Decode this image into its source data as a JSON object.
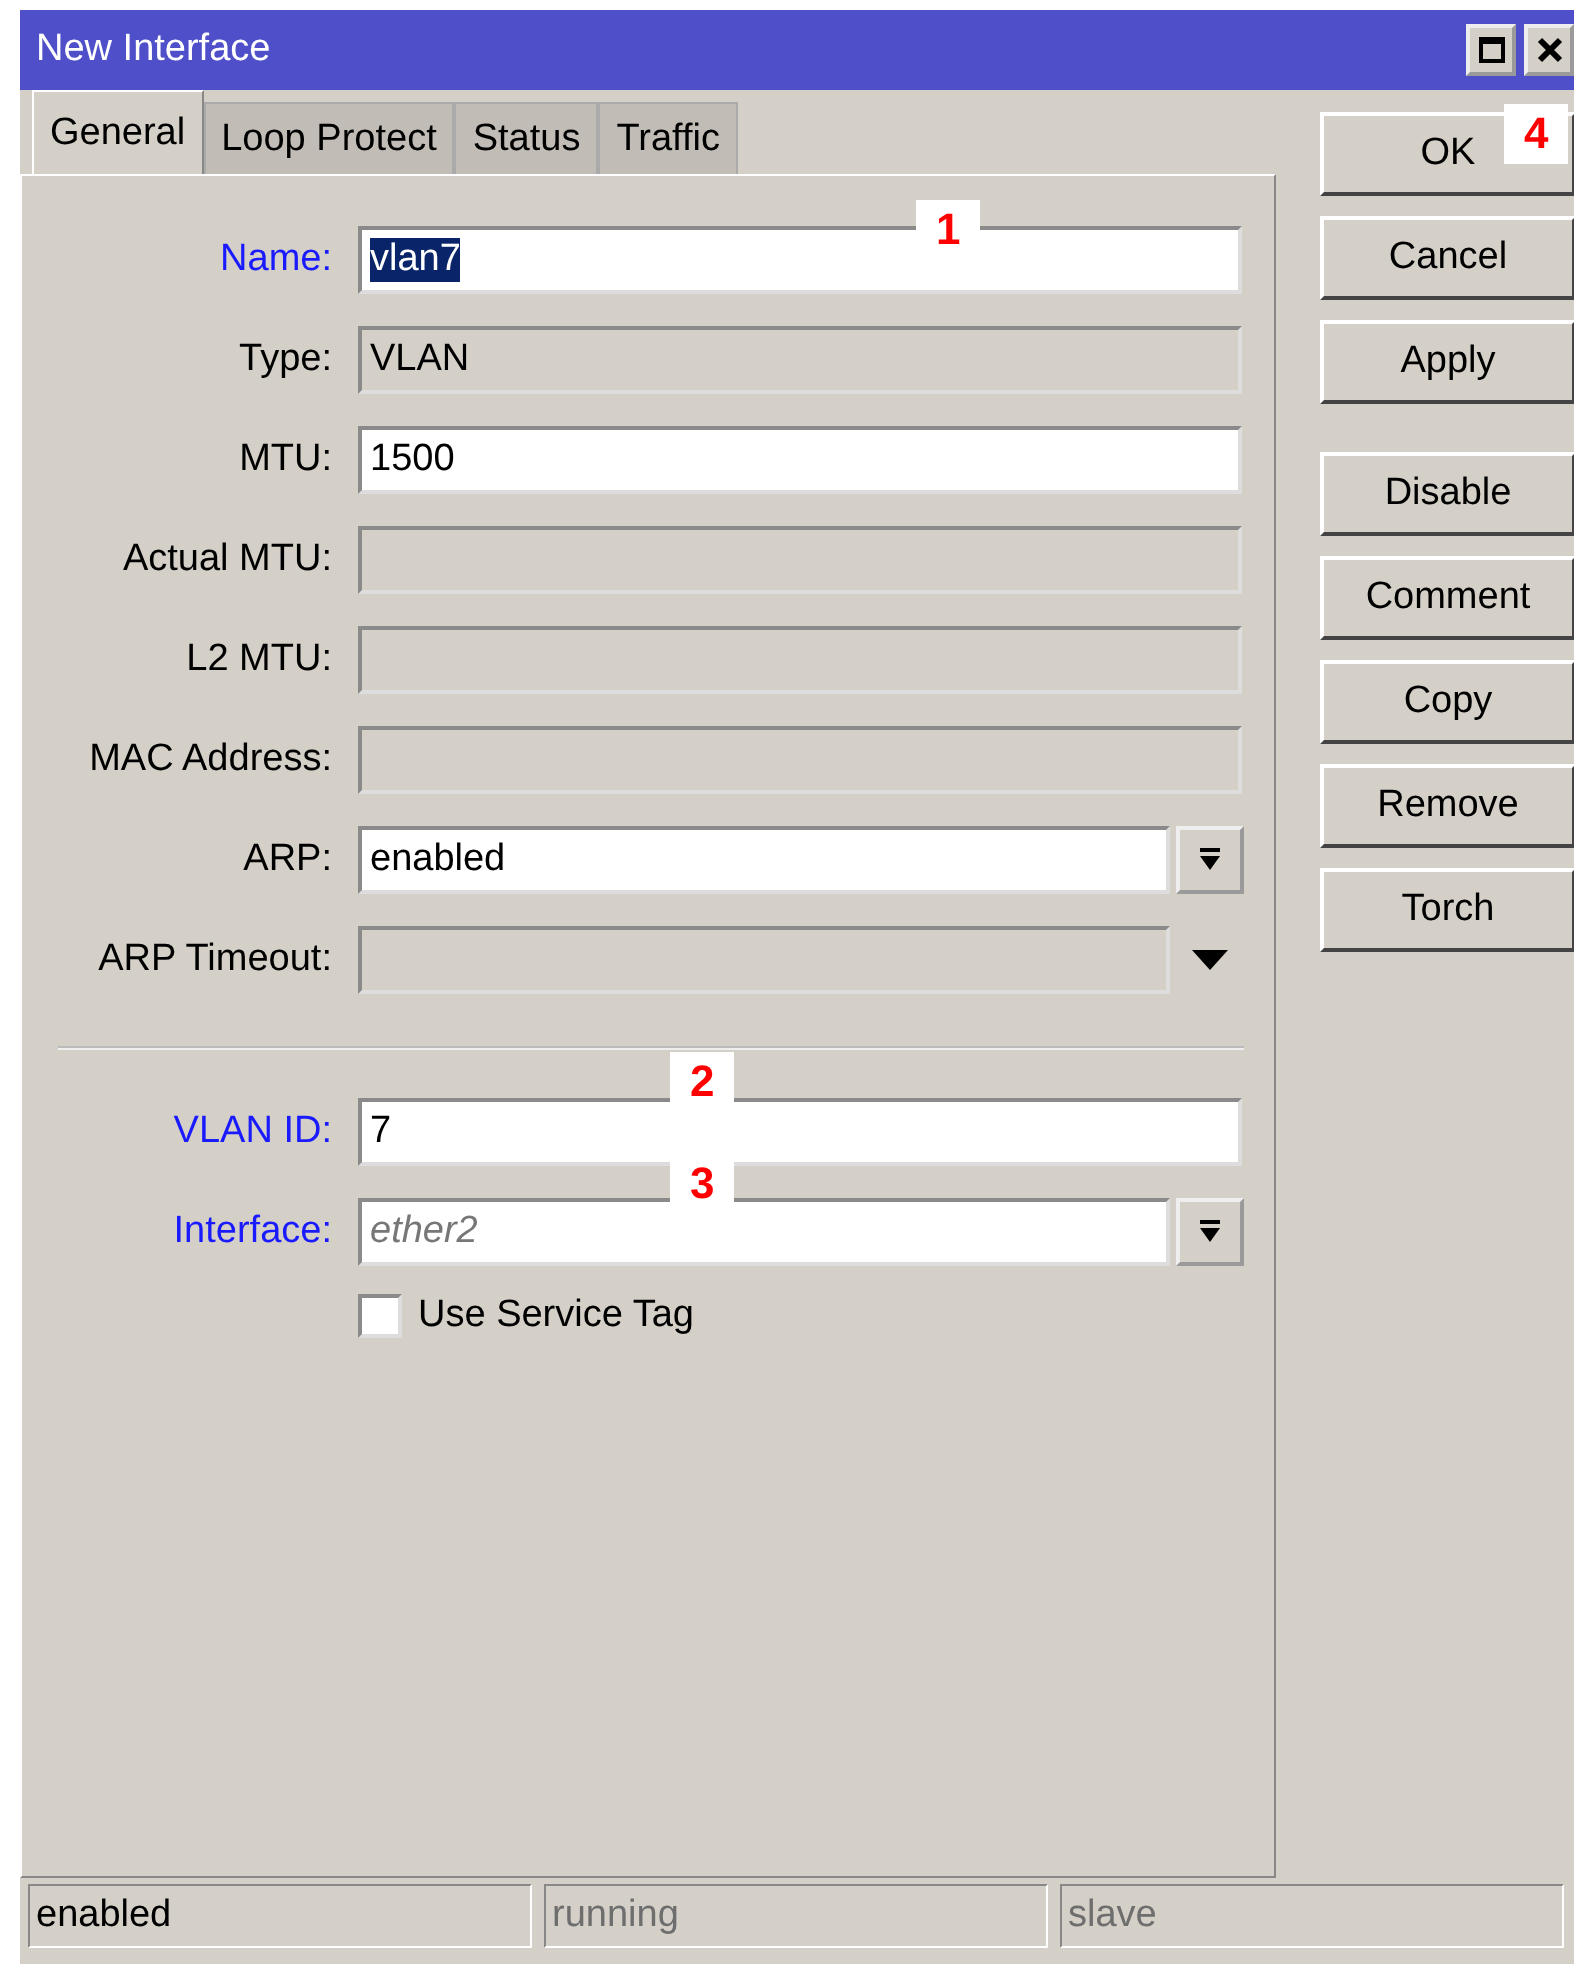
{
  "window": {
    "title": "New Interface"
  },
  "tabs": [
    {
      "label": "General",
      "selected": true
    },
    {
      "label": "Loop Protect",
      "selected": false
    },
    {
      "label": "Status",
      "selected": false
    },
    {
      "label": "Traffic",
      "selected": false
    }
  ],
  "fields": [
    {
      "label": "Name:",
      "kind": "text",
      "value": "vlan7",
      "required": true,
      "value_selected": true
    },
    {
      "label": "Type:",
      "kind": "readonly",
      "value": "VLAN",
      "required": false
    },
    {
      "label": "MTU:",
      "kind": "text",
      "value": "1500",
      "required": false
    },
    {
      "label": "Actual MTU:",
      "kind": "readonly",
      "required": false
    },
    {
      "label": "L2 MTU:",
      "kind": "readonly",
      "required": false
    },
    {
      "label": "MAC Address:",
      "kind": "readonly",
      "required": false
    },
    {
      "label": "ARP:",
      "kind": "dropdown",
      "value": "enabled",
      "required": false
    },
    {
      "label": "ARP Timeout:",
      "kind": "readonly-dropdown",
      "required": false
    },
    {
      "kind": "separator"
    },
    {
      "label": "VLAN ID:",
      "kind": "text",
      "value": "7",
      "required": true
    },
    {
      "label": "Interface:",
      "kind": "dropdown",
      "placeholder": "ether2",
      "required": true
    }
  ],
  "checkbox": {
    "label": "Use Service Tag",
    "checked": false
  },
  "button_groups": [
    [
      "OK",
      "Cancel",
      "Apply"
    ],
    [
      "Disable",
      "Comment",
      "Copy",
      "Remove",
      "Torch"
    ]
  ],
  "status_bar": [
    {
      "text": "enabled",
      "disabled": false
    },
    {
      "text": "running",
      "disabled": true
    },
    {
      "text": "slave",
      "disabled": true
    }
  ],
  "annotations": [
    "1",
    "2",
    "3",
    "4"
  ]
}
